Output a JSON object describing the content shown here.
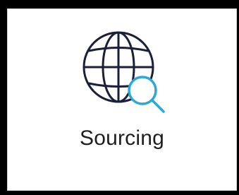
{
  "tile": {
    "label": "Sourcing",
    "icon": "globe-search-icon",
    "colors": {
      "globe": "#1b1f3b",
      "magnifier": "#29a9d8",
      "background": "#ffffff",
      "frame": "#000000"
    }
  }
}
